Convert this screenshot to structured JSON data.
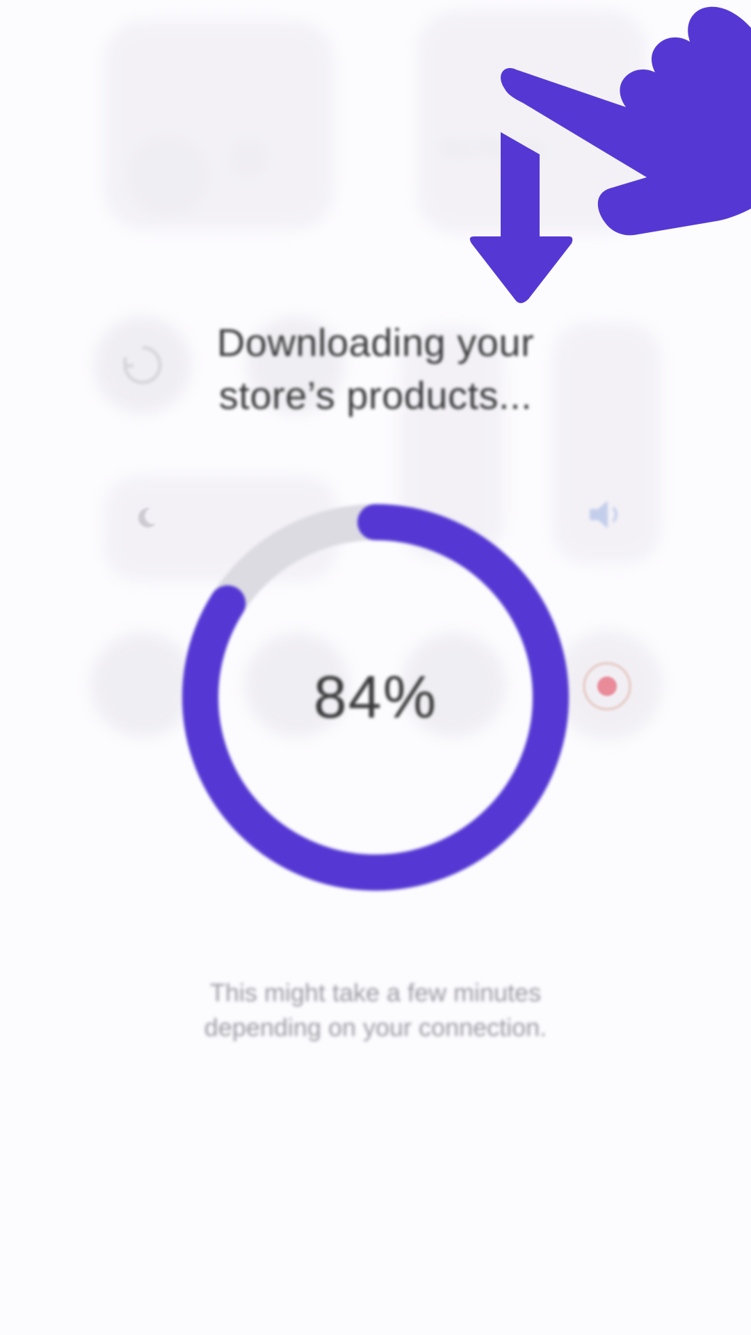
{
  "loader": {
    "title_line1": "Downloading your",
    "title_line2": "store’s products...",
    "percent_text": "84%",
    "progress_fraction": 0.84,
    "subtitle_line1": "This might take a few minutes",
    "subtitle_line2": "depending on your connection."
  },
  "backdrop": {
    "now_playing_label": "Not Playing"
  },
  "icons": {
    "gesture_hand": "pointing-hand-icon",
    "gesture_arrow": "arrow-down-icon",
    "record": "screen-record-icon",
    "volume": "speaker-icon",
    "focus": "moon-icon",
    "rotation": "rotation-lock-icon"
  },
  "colors": {
    "accent": "#5538d4",
    "ring_track": "#dcdbe2",
    "background": "#fcfbfe",
    "title_text": "#3a3a3c",
    "subtitle_text": "#9c9ba3",
    "record_dot": "#e3485c"
  }
}
